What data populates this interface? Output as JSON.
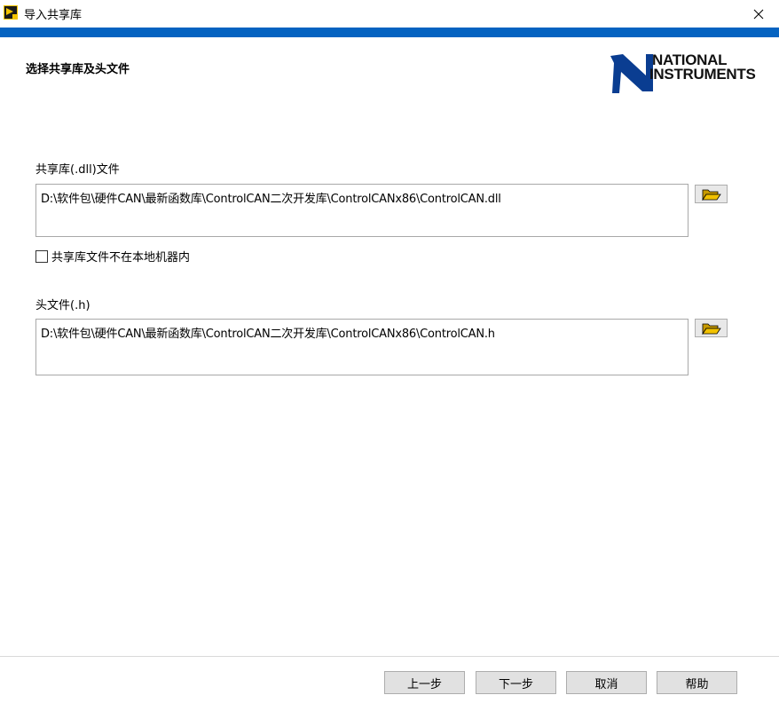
{
  "window": {
    "title": "导入共享库",
    "close_symbol": "✕"
  },
  "page": {
    "heading": "选择共享库及头文件"
  },
  "logo": {
    "line1": "NATIONAL",
    "line2": "INSTRUMENTS",
    "color": "#0a3d91"
  },
  "dll": {
    "label": "共享库(.dll)文件",
    "path": "D:\\软件包\\硬件CAN\\最新函数库\\ControlCAN二次开发库\\ControlCANx86\\ControlCAN.dll"
  },
  "not_local_checkbox": {
    "label": "共享库文件不在本地机器内",
    "checked": false
  },
  "header": {
    "label": "头文件(.h)",
    "path": "D:\\软件包\\硬件CAN\\最新函数库\\ControlCAN二次开发库\\ControlCANx86\\ControlCAN.h"
  },
  "buttons": {
    "back": "上一步",
    "next": "下一步",
    "cancel": "取消",
    "help": "帮助"
  },
  "colors": {
    "accent_bar": "#0563c1",
    "folder_icon": "#f2c200"
  },
  "icons": {
    "browse": "folder-open-icon",
    "app": "labview-icon",
    "close": "close-icon"
  }
}
